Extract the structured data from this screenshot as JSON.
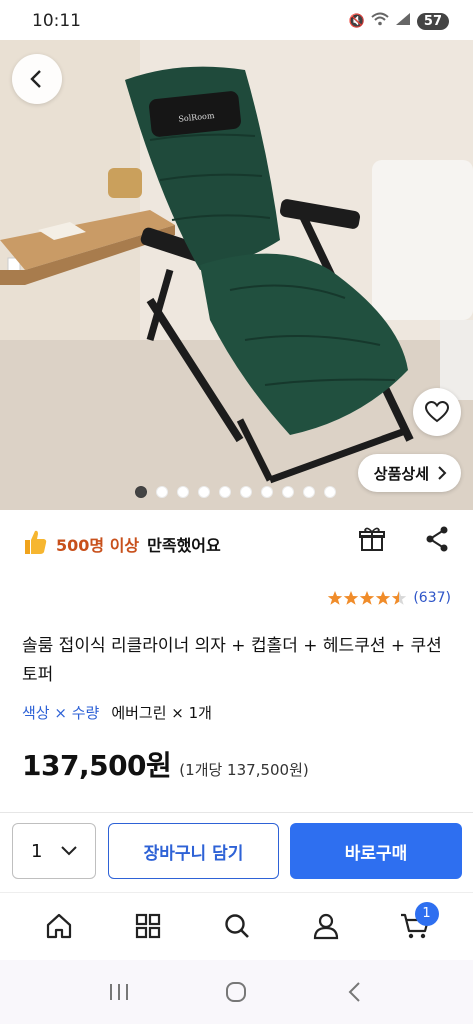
{
  "status_bar": {
    "time": "10:11",
    "battery": "57"
  },
  "hero": {
    "detail_button_label": "상품상세",
    "image_count": 10,
    "active_index": 0,
    "logo_text": "SolRoom"
  },
  "satisfaction": {
    "highlight": "500명 이상",
    "text": "만족했어요"
  },
  "rating": {
    "stars": 4.5,
    "count": "(637)"
  },
  "product": {
    "title": "솔룸 접이식 리클라이너 의자 + 컵홀더 + 헤드쿠션 + 쿠션토퍼",
    "option_label": "색상 × 수량",
    "option_value": "에버그린 × 1개",
    "price": "137,500원",
    "unit_price": "(1개당 137,500원)"
  },
  "buy_bar": {
    "quantity": "1",
    "cart_label": "장바구니 담기",
    "buy_label": "바로구매"
  },
  "bottom_nav": {
    "cart_count": "1"
  },
  "colors": {
    "accent": "#2e6ff0",
    "highlight": "#c8501b",
    "star": "#f08c2a",
    "chair": "#1f4a3b"
  },
  "icons": [
    "back-icon",
    "heart-icon",
    "chevron-right-icon",
    "thumbs-up-icon",
    "gift-icon",
    "share-icon",
    "star-icon",
    "chevron-down-icon",
    "home-icon",
    "category-icon",
    "search-icon",
    "user-icon",
    "cart-icon"
  ]
}
